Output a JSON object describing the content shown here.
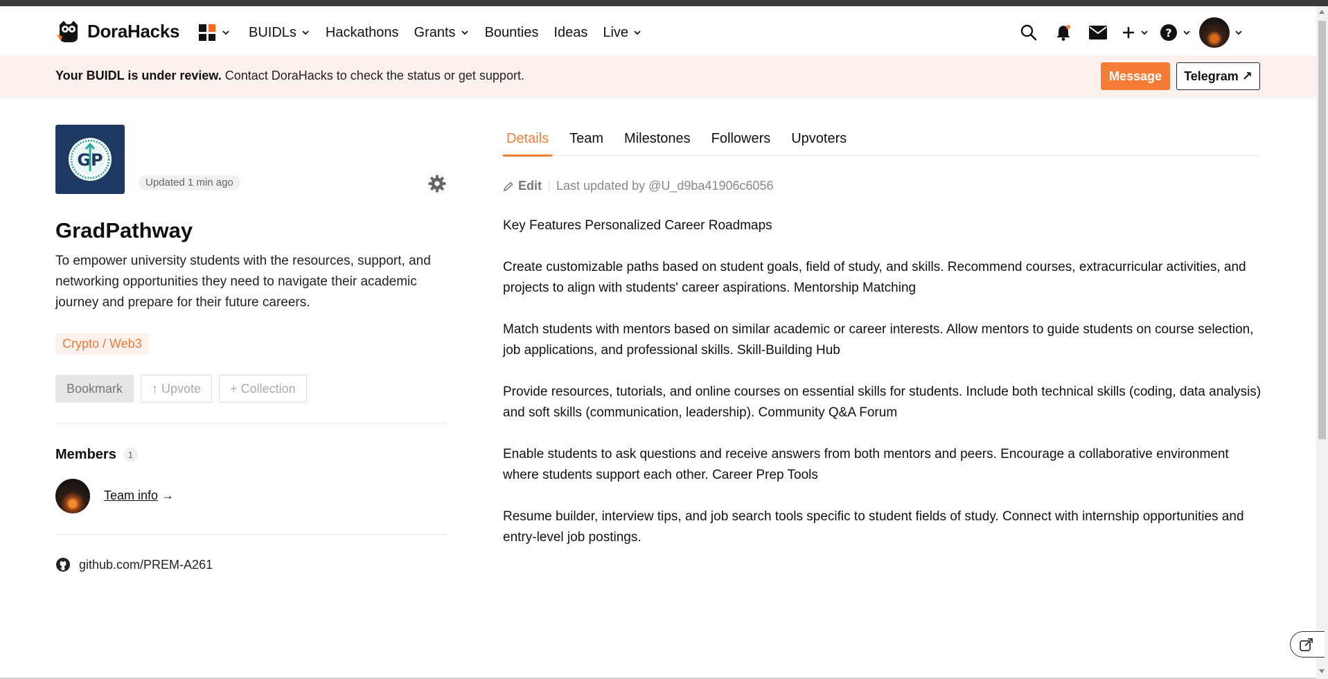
{
  "brand": {
    "name": "DoraHacks",
    "accent": "#f47c36"
  },
  "nav": {
    "items": [
      {
        "label": "BUIDLs",
        "dropdown": true
      },
      {
        "label": "Hackathons",
        "dropdown": false
      },
      {
        "label": "Grants",
        "dropdown": true
      },
      {
        "label": "Bounties",
        "dropdown": false
      },
      {
        "label": "Ideas",
        "dropdown": false
      },
      {
        "label": "Live",
        "dropdown": true
      }
    ],
    "right_icons": [
      "search-icon",
      "bell-icon",
      "mail-icon",
      "plus-icon",
      "help-icon",
      "user-avatar"
    ]
  },
  "banner": {
    "bold": "Your BUIDL is under review.",
    "text": " Contact DoraHacks to check the status or get support.",
    "message_button": "Message",
    "telegram_button": "Telegram ↗"
  },
  "project": {
    "updated": "Updated 1 min ago",
    "name": "GradPathway",
    "description": "To empower university students with the resources, support, and networking opportunities they need to navigate their academic journey and prepare for their future careers.",
    "tag": "Crypto / Web3",
    "actions": {
      "bookmark": "Bookmark",
      "upvote": "↑ Upvote",
      "collection": "+ Collection"
    },
    "members_title": "Members",
    "members_count": "1",
    "team_info": "Team info",
    "team_info_arrow": " →",
    "github": "github.com/PREM-A261"
  },
  "tabs": [
    {
      "label": "Details",
      "active": true
    },
    {
      "label": "Team",
      "active": false
    },
    {
      "label": "Milestones",
      "active": false
    },
    {
      "label": "Followers",
      "active": false
    },
    {
      "label": "Upvoters",
      "active": false
    }
  ],
  "details": {
    "edit_label": "Edit",
    "last_updated": "Last updated by @U_d9ba41906c6056",
    "paragraphs": [
      "Key Features Personalized Career Roadmaps",
      "Create customizable paths based on student goals, field of study, and skills. Recommend courses, extracurricular activities, and projects to align with students' career aspirations. Mentorship Matching",
      "Match students with mentors based on similar academic or career interests. Allow mentors to guide students on course selection, job applications, and professional skills. Skill-Building Hub",
      "Provide resources, tutorials, and online courses on essential skills for students. Include both technical skills (coding, data analysis) and soft skills (communication, leadership). Community Q&A Forum",
      "Enable students to ask questions and receive answers from both mentors and peers. Encourage a collaborative environment where students support each other. Career Prep Tools",
      "Resume builder, interview tips, and job search tools specific to student fields of study. Connect with internship opportunities and entry-level job postings."
    ]
  }
}
